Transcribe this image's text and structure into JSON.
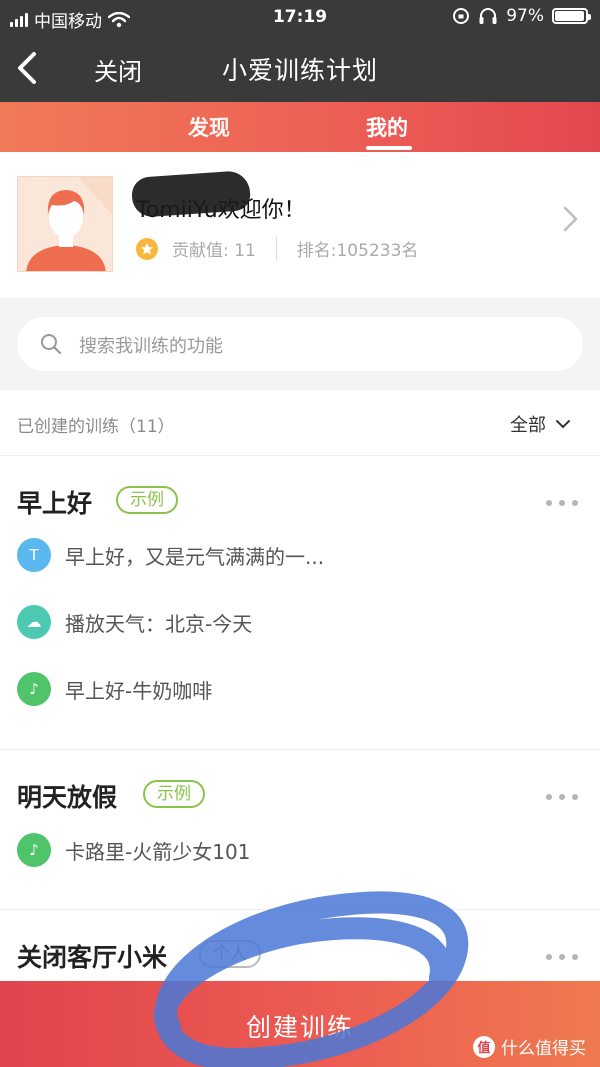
{
  "status_bar": {
    "carrier": "中国移动",
    "time": "17:19",
    "battery": "97%",
    "battery_level": 0.97
  },
  "nav": {
    "close_label": "关闭",
    "title": "小爱训练计划"
  },
  "tabs": [
    {
      "label": "发现",
      "active": false
    },
    {
      "label": "我的",
      "active": true
    }
  ],
  "profile": {
    "greeting": "TomiiYu欢迎你！",
    "contribution_label": "贡献值: 11",
    "rank_label": "排名:105233名"
  },
  "search": {
    "placeholder": "搜索我训练的功能"
  },
  "list_header": {
    "count_label": "已创建的训练（11）",
    "filter_label": "全部"
  },
  "cards": [
    {
      "title": "早上好",
      "tag": "示例",
      "actions": [
        {
          "icon": "text-icon",
          "glyph": "T",
          "color": "#5ab8ee",
          "text": "早上好，又是元气满满的一..."
        },
        {
          "icon": "cloud-icon",
          "glyph": "☁",
          "color": "#4cc9b0",
          "text": "播放天气：北京-今天"
        },
        {
          "icon": "music-icon",
          "glyph": "♪",
          "color": "#4fc46b",
          "text": "早上好-牛奶咖啡"
        }
      ]
    },
    {
      "title": "明天放假",
      "tag": "示例",
      "actions": [
        {
          "icon": "music-icon",
          "glyph": "♪",
          "color": "#4fc46b",
          "text": "卡路里-火箭少女101"
        }
      ]
    },
    {
      "title": "关闭客厅小米",
      "tag": "个人",
      "actions": []
    }
  ],
  "cta": {
    "label": "创建训练"
  },
  "watermark": {
    "badge": "值",
    "text": "什么值得买"
  },
  "colors": {
    "accent": "#ec5d55",
    "tag_green": "#8bc34a",
    "nav_bg": "#3a3a3a"
  }
}
